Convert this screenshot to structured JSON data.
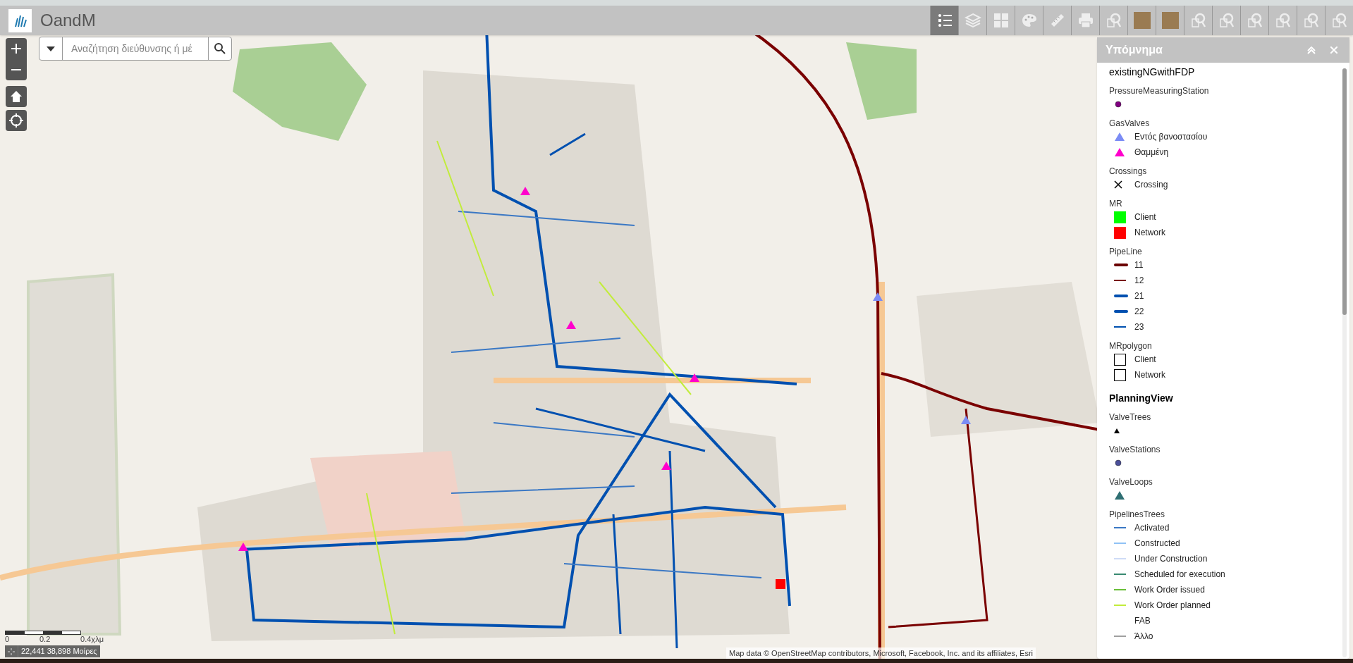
{
  "app": {
    "title": "OandM"
  },
  "search": {
    "placeholder": "Αναζήτηση διεύθυνσης ή μέ"
  },
  "toolbar": [
    {
      "kind": "legend",
      "selected": true
    },
    {
      "kind": "layers",
      "selected": false
    },
    {
      "kind": "basemap",
      "selected": false
    },
    {
      "kind": "palette",
      "selected": false
    },
    {
      "kind": "ruler",
      "selected": false
    },
    {
      "kind": "print",
      "selected": false
    },
    {
      "kind": "query",
      "selected": false
    },
    {
      "kind": "thumbnail",
      "selected": false
    },
    {
      "kind": "thumbnail",
      "selected": false
    },
    {
      "kind": "query",
      "selected": false
    },
    {
      "kind": "query",
      "selected": false
    },
    {
      "kind": "query",
      "selected": false
    },
    {
      "kind": "query",
      "selected": false
    },
    {
      "kind": "query",
      "selected": false
    },
    {
      "kind": "query",
      "selected": false
    }
  ],
  "legend": {
    "title": "Υπόμνημα",
    "layers": [
      {
        "title": "existingNGwithFDP",
        "sections": [
          {
            "title": "PressureMeasuringStation",
            "items": [
              {
                "kind": "dot",
                "color": "#800080"
              }
            ]
          },
          {
            "title": "GasValves",
            "items": [
              {
                "kind": "triangle",
                "color": "#7b8cf5",
                "label": "Εντός βανοστασίου"
              },
              {
                "kind": "triangle",
                "color": "#ff00cc",
                "label": "Θαμμένη"
              }
            ]
          },
          {
            "title": "Crossings",
            "items": [
              {
                "kind": "cross",
                "color": "#000000",
                "label": "Crossing"
              }
            ]
          },
          {
            "title": "MR",
            "items": [
              {
                "kind": "square",
                "color": "#00ff00",
                "label": "Client"
              },
              {
                "kind": "square",
                "color": "#ff0000",
                "label": "Network"
              }
            ]
          },
          {
            "title": "PipeLine",
            "items": [
              {
                "kind": "thick-line",
                "color": "#6b0000",
                "label": "11"
              },
              {
                "kind": "line",
                "color": "#7a0000",
                "label": "12"
              },
              {
                "kind": "thick-line",
                "color": "#0050b0",
                "label": "21"
              },
              {
                "kind": "thick-line",
                "color": "#0050b0",
                "label": "22"
              },
              {
                "kind": "line",
                "color": "#0050b0",
                "label": "23"
              }
            ]
          },
          {
            "title": "MRpolygon",
            "items": [
              {
                "kind": "outline-square",
                "color": "#000000",
                "label": "Client"
              },
              {
                "kind": "outline-square",
                "color": "#000000",
                "label": "Network"
              }
            ]
          }
        ]
      },
      {
        "title": "PlanningView",
        "sections": [
          {
            "title": "ValveTrees",
            "items": [
              {
                "kind": "small-triangle",
                "color": "#000000"
              }
            ]
          },
          {
            "title": "ValveStations",
            "items": [
              {
                "kind": "dot",
                "color": "#4a4f9a"
              }
            ]
          },
          {
            "title": "ValveLoops",
            "items": [
              {
                "kind": "triangle",
                "color": "#2f6f73"
              }
            ]
          },
          {
            "title": "PipelinesTrees",
            "items": [
              {
                "kind": "line",
                "color": "#3b78c4",
                "label": "Activated"
              },
              {
                "kind": "line",
                "color": "#90c2f5",
                "label": "Constructed"
              },
              {
                "kind": "line",
                "color": "#cfdcf7",
                "label": "Under Construction"
              },
              {
                "kind": "line",
                "color": "#3a8a72",
                "label": "Scheduled for execution"
              },
              {
                "kind": "line",
                "color": "#6abf3a",
                "label": "Work Order issued"
              },
              {
                "kind": "line",
                "color": "#c2ec3c",
                "label": "Work Order planned"
              },
              {
                "kind": "none",
                "label": "FAB"
              },
              {
                "kind": "line",
                "color": "#a0a0a0",
                "label": "Άλλο"
              }
            ]
          }
        ]
      }
    ]
  },
  "scale": {
    "labels": [
      "0",
      "0.2",
      "0.4χλμ"
    ]
  },
  "coordinates": "22,441 38,898 Μοίρες",
  "attribution": "Map data © OpenStreetMap contributors, Microsoft, Facebook, Inc. and its affiliates, Esri"
}
